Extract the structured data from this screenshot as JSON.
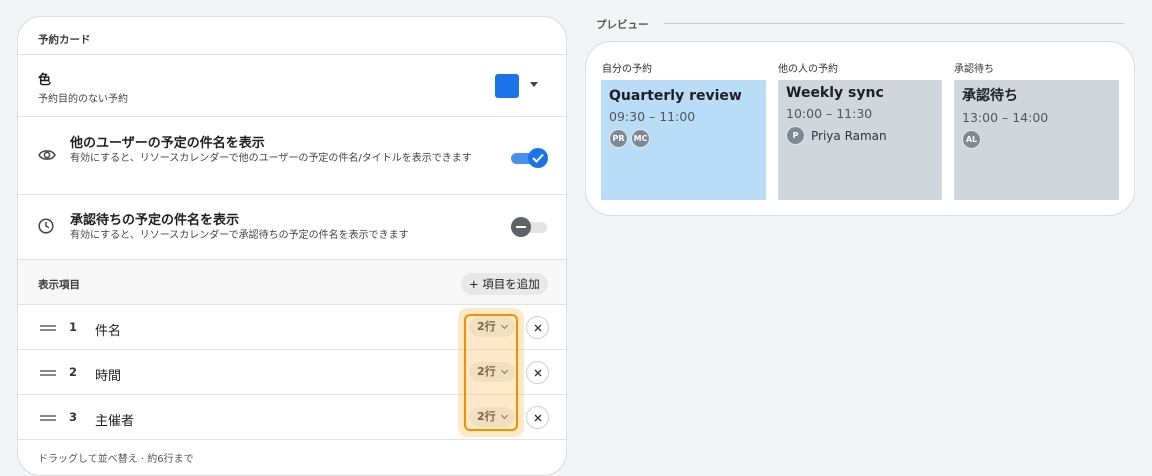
{
  "settings_card": {
    "title": "予約カード",
    "color": {
      "title": "色",
      "subtitle": "予約目的のない予約",
      "swatch_color": "#1a73e8"
    },
    "show_other_titles": {
      "title": "他のユーザーの予定の件名を表示",
      "description": "有効にすると、リソースカレンダーで他のユーザーの予定の件名/タイトルを表示できます",
      "enabled": true
    },
    "show_pending_titles": {
      "title": "承認待ちの予定の件名を表示",
      "description": "有効にすると、リソースカレンダーで承認待ちの予定の件名を表示できます",
      "enabled": false
    },
    "display_items": {
      "label": "表示項目",
      "add_button": "+ 項目を追加",
      "items": [
        {
          "number": "1",
          "name": "件名",
          "lines": "2行"
        },
        {
          "number": "2",
          "name": "時間",
          "lines": "2行"
        },
        {
          "number": "3",
          "name": "主催者",
          "lines": "2行"
        }
      ],
      "footer_note": "ドラッグして並べ替え · 約6行まで"
    }
  },
  "preview": {
    "heading": "プレビュー",
    "columns": [
      {
        "label": "自分の予約",
        "title": "Quarterly review",
        "time": "09:30 – 11:00",
        "avatars": [
          "PR",
          "MC"
        ],
        "attendee_name": "",
        "color": "#b9dcf7"
      },
      {
        "label": "他の人の予約",
        "title": "Weekly sync",
        "time": "10:00 – 11:30",
        "avatars": [
          "P"
        ],
        "attendee_name": "Priya Raman",
        "color": "#d0d7dc"
      },
      {
        "label": "承認待ち",
        "title": "承認待ち",
        "time": "13:00 – 14:00",
        "avatars": [
          "AL"
        ],
        "attendee_name": "",
        "color": "#d0d7dc"
      }
    ]
  }
}
